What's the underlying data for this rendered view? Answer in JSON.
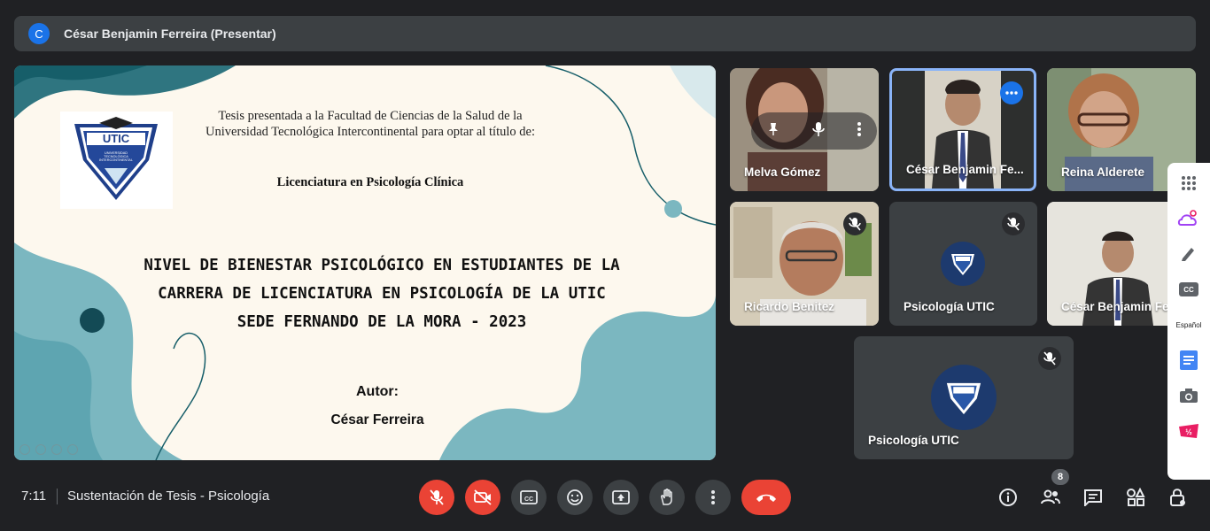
{
  "top_bar": {
    "avatar_letter": "C",
    "presenter_label": "César Benjamin Ferreira (Presentar)"
  },
  "slide": {
    "intro_text": "Tesis presentada a la Facultad de Ciencias de la Salud de la Universidad Tecnológica Intercontinental para optar al título de:",
    "degree": "Licenciatura en Psicología Clínica",
    "title_lines": [
      "NIVEL DE BIENESTAR PSICOLÓGICO EN ESTUDIANTES DE LA",
      "CARRERA DE LICENCIATURA EN PSICOLOGÍA DE LA UTIC",
      "SEDE FERNANDO DE LA MORA - 2023"
    ],
    "author_label": "Autor:",
    "author_name": "César Ferreira",
    "logo_text": "UTIC",
    "logo_subtext": "UNIVERSIDAD TECNOLÓGICA INTERCONTINENTAL"
  },
  "participants": [
    {
      "name": "Melva Gómez",
      "muted": false,
      "pinned_controls": true
    },
    {
      "name": "César Benjamin Fe...",
      "muted": false,
      "selected": true
    },
    {
      "name": "Reina Alderete",
      "muted": false
    },
    {
      "name": "Ricardo Benitez",
      "muted": true
    },
    {
      "name": "Psicología UTIC",
      "muted": true
    },
    {
      "name": "César Benjamin Fe",
      "muted": false
    },
    {
      "name": "Psicología UTIC",
      "muted": true
    }
  ],
  "side_panel": {
    "caption_language": "Español",
    "cc_label": "CC"
  },
  "bottom_bar": {
    "time": "7:11",
    "meeting_title": "Sustentación de Tesis - Psicología",
    "participant_count": "8"
  },
  "colors": {
    "background": "#202124",
    "tile": "#3c4043",
    "danger": "#ea4335",
    "accent": "#1a73e8",
    "selected_border": "#8ab4f8"
  }
}
